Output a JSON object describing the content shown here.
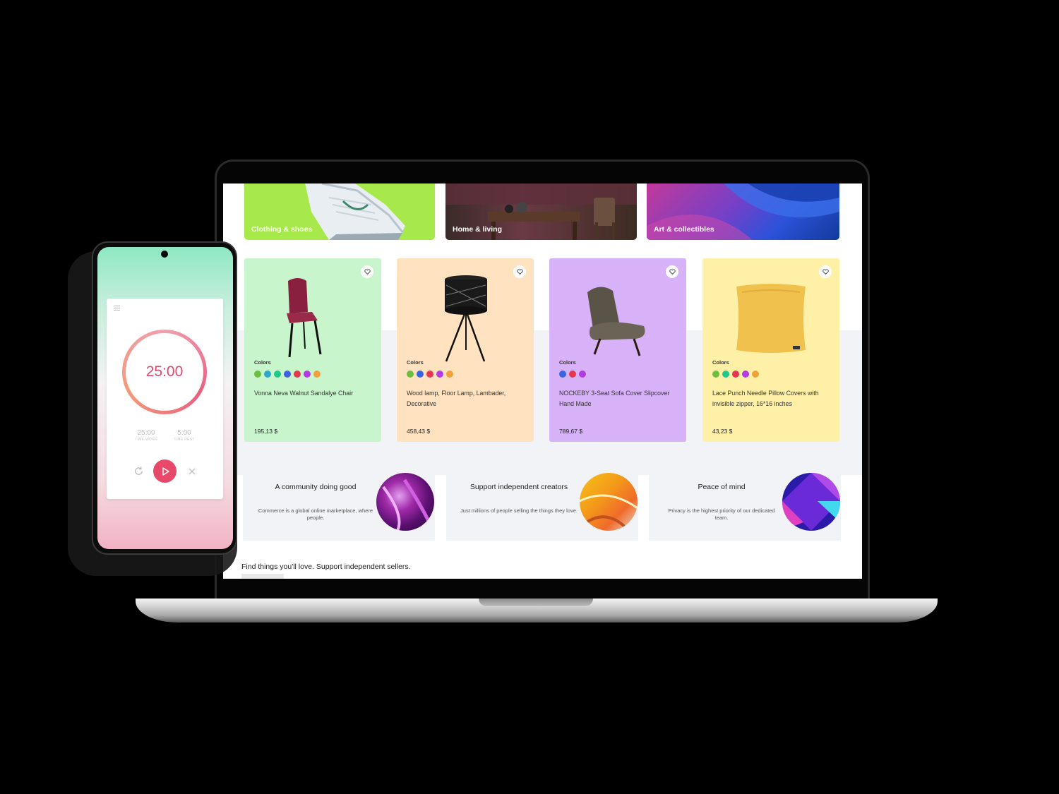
{
  "marketplace": {
    "categories": [
      {
        "label": "Clothing & shoes"
      },
      {
        "label": "Home & living"
      },
      {
        "label": "Art & collectibles"
      }
    ],
    "colors_label": "Colors",
    "products": [
      {
        "name": "Vonna Neva Walnut Sandalye Chair",
        "price": "195,13 $",
        "bg": "#c8f5cc",
        "swatches": [
          "#6cbf3d",
          "#2ba8c9",
          "#1fc98a",
          "#3a63e6",
          "#e6374f",
          "#b43ae6",
          "#f2a03a"
        ]
      },
      {
        "name": "Wood lamp, Floor Lamp, Lambader, Decorative",
        "price": "458,43 $",
        "bg": "#ffe2c0",
        "swatches": [
          "#6cbf3d",
          "#3a63e6",
          "#e6374f",
          "#b43ae6",
          "#f2a03a"
        ]
      },
      {
        "name": "NOCKEBY 3-Seat Sofa Cover Slipcover Hand Made",
        "price": "789,67 $",
        "bg": "#d8b2f8",
        "swatches": [
          "#3a63e6",
          "#e6374f",
          "#b43ae6"
        ]
      },
      {
        "name": "Lace Punch Needle Pillow Covers with invisible zipper, 16*16 inches",
        "price": "43,23 $",
        "bg": "#fff0a8",
        "swatches": [
          "#6cbf3d",
          "#1fc98a",
          "#e6374f",
          "#b43ae6",
          "#f2a03a"
        ]
      }
    ],
    "features": [
      {
        "title": "A community doing good",
        "text": "Commerce is a global online marketplace, where people."
      },
      {
        "title": "Support independent creators",
        "text": "Just millions of people selling the things they love."
      },
      {
        "title": "Peace of mind",
        "text": "Privacy is the highest priority of our dedicated team."
      }
    ],
    "footer_text": "Find things you'll love. Support independent sellers."
  },
  "timer_app": {
    "time_display": "25:00",
    "time_work_value": "25:00",
    "time_work_label": "TIME WORK",
    "time_rest_value": "5:00",
    "time_rest_label": "TIME REST"
  },
  "colors": {
    "accent_pink": "#e8496a"
  }
}
